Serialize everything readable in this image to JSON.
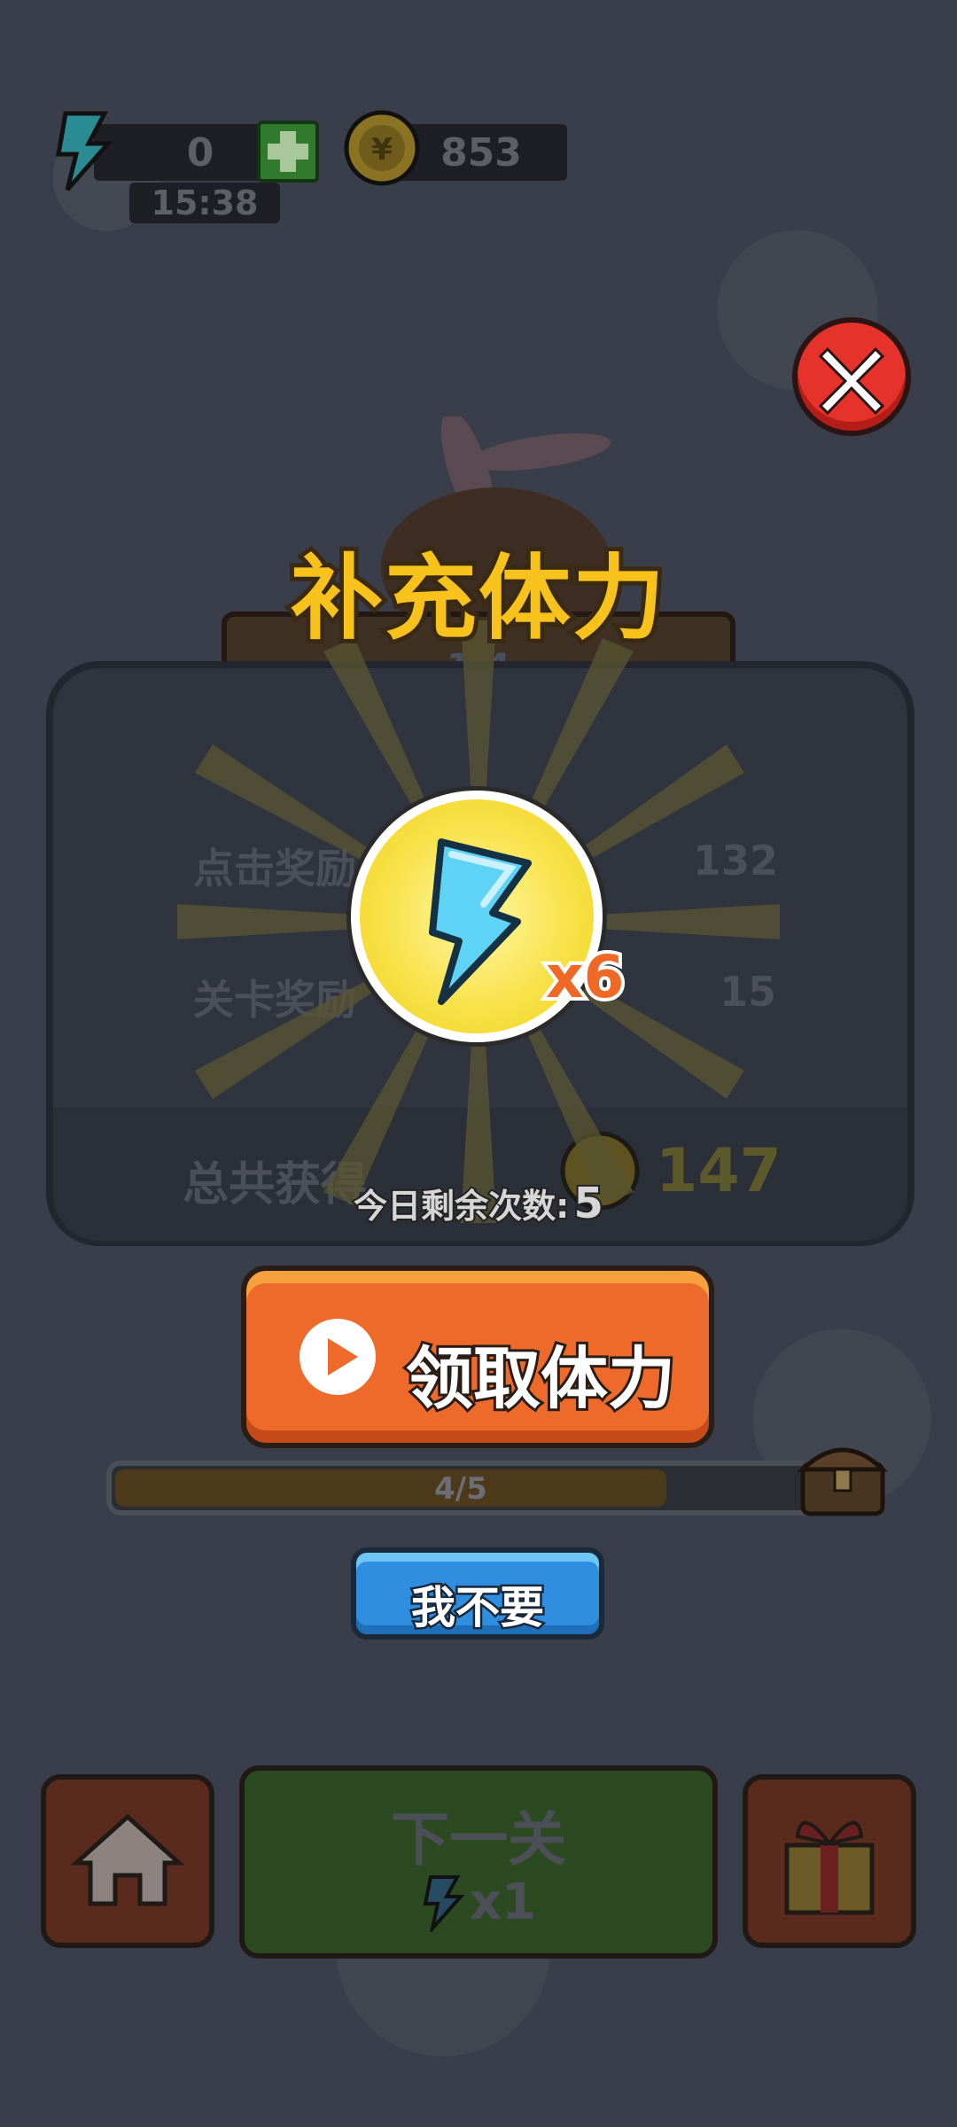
{
  "hud": {
    "energy_value": "0",
    "energy_timer": "15:38",
    "coins_value": "853"
  },
  "level_banner": {
    "level": "1-4"
  },
  "results": {
    "row1_label": "点击奖励",
    "row1_value": "132",
    "row2_label": "关卡奖励",
    "row2_value": "15",
    "total_label": "总共获得",
    "total_value": "147"
  },
  "popup": {
    "title": "补充体力",
    "reward_multiplier": "x6",
    "remaining_label": "今日剩余次数:",
    "remaining_value": "5",
    "claim_label": "领取体力",
    "progress_text": "4/5",
    "progress_fraction": 0.8,
    "decline_label": "我不要"
  },
  "bottom": {
    "next_label": "下一关",
    "next_cost": "x1"
  },
  "colors": {
    "orange": "#ee6a2a",
    "blue": "#2f8ee0",
    "gold": "#f5c31a",
    "red_close": "#e5322b"
  }
}
